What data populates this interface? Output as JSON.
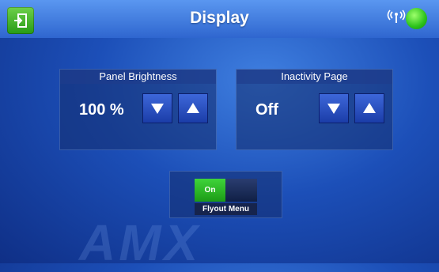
{
  "header": {
    "title": "Display",
    "exit_icon": "exit-door-icon",
    "signal_icon": "wireless-signal-icon",
    "status_color": "#2bc21a"
  },
  "panels": {
    "brightness": {
      "label": "Panel Brightness",
      "value": "100 %"
    },
    "inactivity": {
      "label": "Inactivity Page",
      "value": "Off"
    }
  },
  "controls": {
    "down_icon": "arrow-down-icon",
    "up_icon": "arrow-up-icon"
  },
  "flyout": {
    "on_label": "On",
    "label": "Flyout Menu",
    "state": "on"
  },
  "watermark": {
    "text": "AMX"
  },
  "colors": {
    "background": "#1c4fb8",
    "accent_green": "#2bc21a",
    "button_blue": "#2a4fc4"
  }
}
